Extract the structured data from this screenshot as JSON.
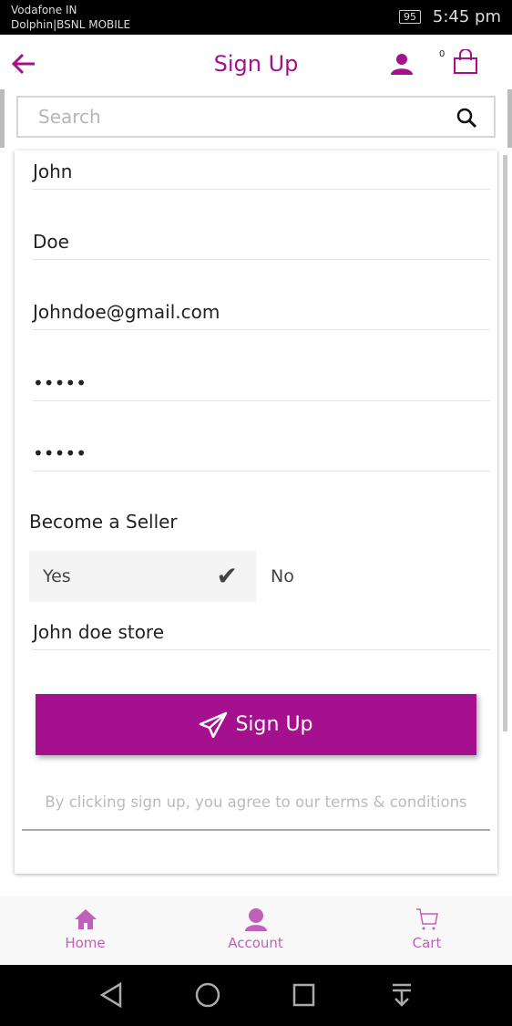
{
  "status_bar": {
    "carrier1": "Vodafone IN",
    "carrier2": "Dolphin|BSNL MOBILE",
    "battery": "95",
    "time": "5:45 pm"
  },
  "header": {
    "title": "Sign Up",
    "cart_count": "0"
  },
  "search": {
    "placeholder": "Search"
  },
  "form": {
    "first_name": "John",
    "last_name": "Doe",
    "email": "Johndoe@gmail.com",
    "password": "•••••",
    "confirm_password": "•••••",
    "seller_label": "Become a Seller",
    "yes_label": "Yes",
    "no_label": "No",
    "seller_selected": "Yes",
    "store_name": "John doe store",
    "submit_label": "Sign Up",
    "terms": "By clicking sign up, you agree to our terms & conditions"
  },
  "bottom_nav": [
    {
      "label": "Home",
      "icon": "home-icon"
    },
    {
      "label": "Account",
      "icon": "account-icon"
    },
    {
      "label": "Cart",
      "icon": "cart-icon"
    }
  ],
  "colors": {
    "accent": "#a5108f",
    "nav": "#c060b8"
  }
}
